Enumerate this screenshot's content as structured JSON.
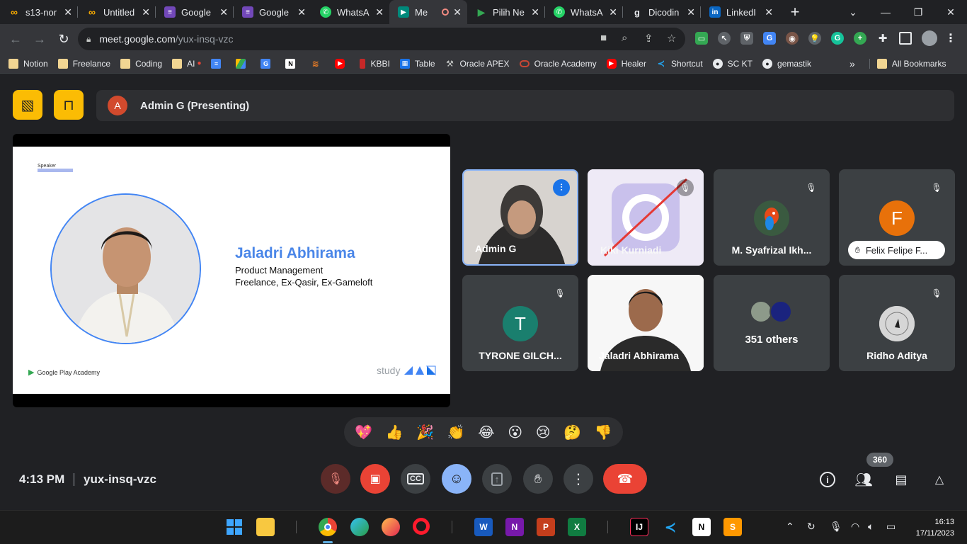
{
  "browser": {
    "tabs": [
      {
        "title": "s13-nor",
        "icon": "colab-icon",
        "color": "#f9ab00"
      },
      {
        "title": "Untitled",
        "icon": "colab-icon",
        "color": "#f9ab00"
      },
      {
        "title": "Google",
        "icon": "google-forms-icon",
        "color": "#7248b9"
      },
      {
        "title": "Google",
        "icon": "google-forms-icon",
        "color": "#7248b9"
      },
      {
        "title": "WhatsA",
        "icon": "whatsapp-icon",
        "color": "#25d366"
      },
      {
        "title": "Me",
        "icon": "google-meet-icon",
        "color": "#00897b"
      },
      {
        "title": "Pilih Ne",
        "icon": "google-play-icon",
        "color": "#01875f"
      },
      {
        "title": "WhatsA",
        "icon": "whatsapp-icon",
        "color": "#25d366"
      },
      {
        "title": "Dicodin",
        "icon": "dicoding-icon",
        "color": "#2d3e50"
      },
      {
        "title": "LinkedI",
        "icon": "linkedin-icon",
        "color": "#0a66c2"
      }
    ],
    "url_host": "meet.google.com",
    "url_path": "/yux-insq-vzc",
    "bookmarks": [
      {
        "label": "Notion",
        "icon": "folder-icon"
      },
      {
        "label": "Freelance",
        "icon": "folder-icon"
      },
      {
        "label": "Coding",
        "icon": "folder-icon"
      },
      {
        "label": "AI",
        "icon": "folder-icon"
      },
      {
        "label": "",
        "icon": "google-docs-icon"
      },
      {
        "label": "",
        "icon": "google-drive-icon"
      },
      {
        "label": "",
        "icon": "google-translate-icon"
      },
      {
        "label": "",
        "icon": "notion-icon"
      },
      {
        "label": "",
        "icon": "stackoverflow-icon"
      },
      {
        "label": "",
        "icon": "youtube-icon"
      },
      {
        "label": "KBBI",
        "icon": "kbbi-icon"
      },
      {
        "label": "Table",
        "icon": "table-icon"
      },
      {
        "label": "Oracle APEX",
        "icon": "oracle-apex-icon"
      },
      {
        "label": "Oracle Academy",
        "icon": "oracle-icon"
      },
      {
        "label": "Healer",
        "icon": "youtube-icon"
      },
      {
        "label": "Shortcut",
        "icon": "vscode-icon"
      },
      {
        "label": "SC KT",
        "icon": "github-icon"
      },
      {
        "label": "gemastik",
        "icon": "github-icon"
      }
    ],
    "overflow": "»",
    "all_bookmarks": "All Bookmarks"
  },
  "meet": {
    "presenting_initial": "A",
    "presenting_text": "Admin G (Presenting)",
    "slide": {
      "tag": "Speaker",
      "name": "Jaladri Abhirama",
      "role": "Product Management",
      "affiliation": "Freelance, Ex-Qasir, Ex-Gameloft",
      "footer_left": "Google Play Academy",
      "footer_right": "study"
    },
    "participants": [
      {
        "name": "Admin G",
        "initial": "",
        "muted": false,
        "speaking": true
      },
      {
        "name": "Kiki Kurniadi",
        "initial": "",
        "muted": true
      },
      {
        "name": "M. Syafrizal Ikh...",
        "initial": "",
        "muted": true
      },
      {
        "name": "Felix Felipe F...",
        "initial": "F",
        "muted": true,
        "avatar_color": "#e8710a"
      },
      {
        "name": "TYRONE GILCH...",
        "initial": "T",
        "muted": true,
        "avatar_color": "#1a7f6e"
      },
      {
        "name": "Jaladri Abhirama",
        "initial": "",
        "muted": false
      },
      {
        "name": "351 others",
        "initial": "",
        "muted": false
      },
      {
        "name": "Ridho Aditya",
        "initial": "",
        "muted": true
      }
    ],
    "reactions": [
      "💖",
      "👍",
      "🎉",
      "👏",
      "😂",
      "😮",
      "😢",
      "🤔",
      "👎"
    ],
    "time": "4:13 PM",
    "meeting_code": "yux-insq-vzc",
    "people_count": "360"
  },
  "taskbar": {
    "time": "16:13",
    "date": "17/11/2023"
  }
}
